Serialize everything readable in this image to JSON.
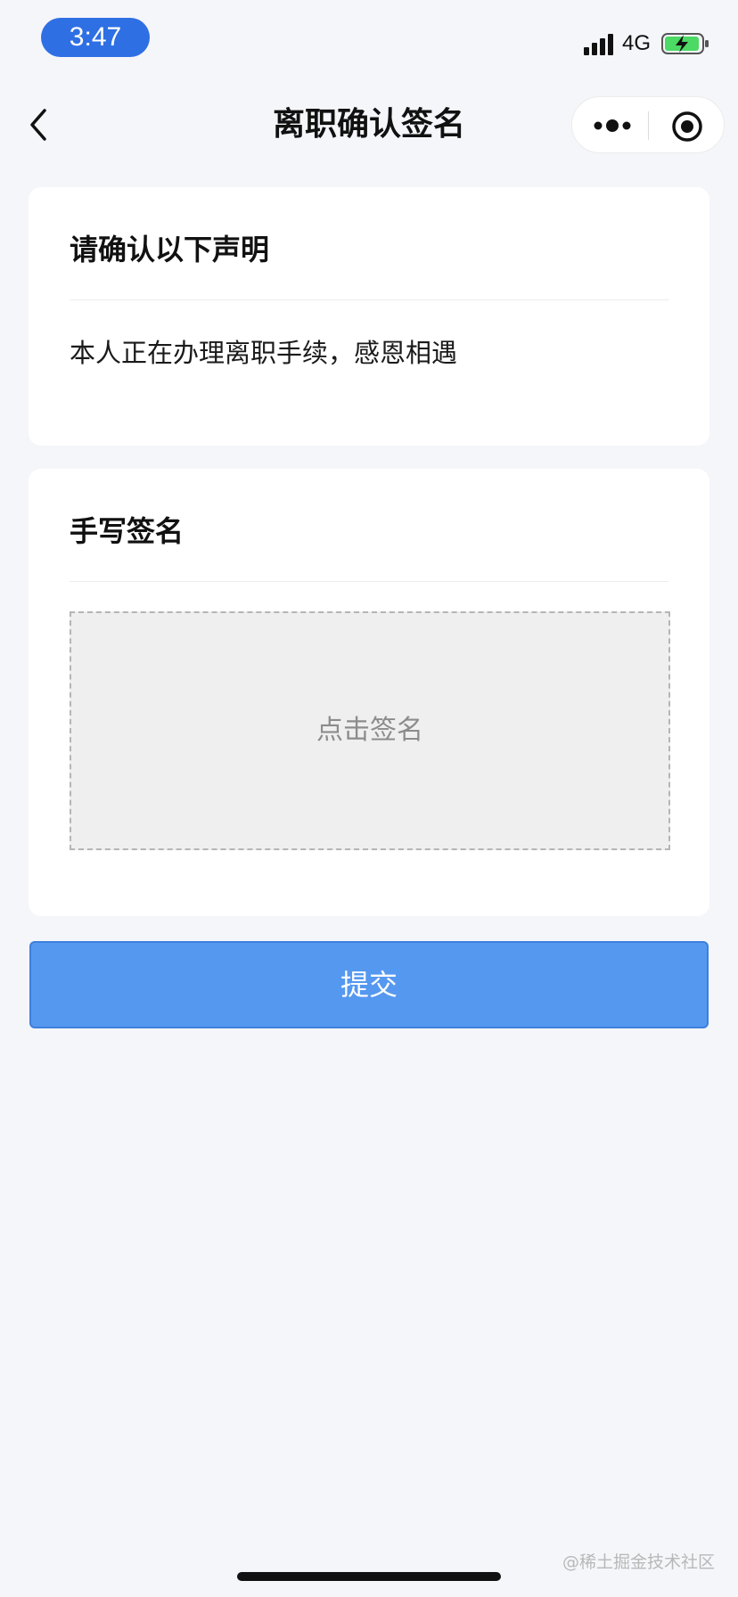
{
  "status_bar": {
    "time": "3:47",
    "network": "4G",
    "icons": [
      "signal-icon",
      "battery-charging-icon"
    ]
  },
  "nav": {
    "title": "离职确认签名",
    "icons": [
      "back-icon",
      "more-icon",
      "close-icon"
    ]
  },
  "declaration": {
    "title": "请确认以下声明",
    "text": "本人正在办理离职手续，感恩相遇"
  },
  "signature": {
    "title": "手写签名",
    "hint": "点击签名"
  },
  "submit": {
    "label": "提交"
  },
  "watermark": "@稀土掘金技术社区",
  "colors": {
    "accent": "#2f6fe4",
    "button": "#5598f0",
    "background": "#f5f6fa",
    "battery": "#4cd964"
  }
}
